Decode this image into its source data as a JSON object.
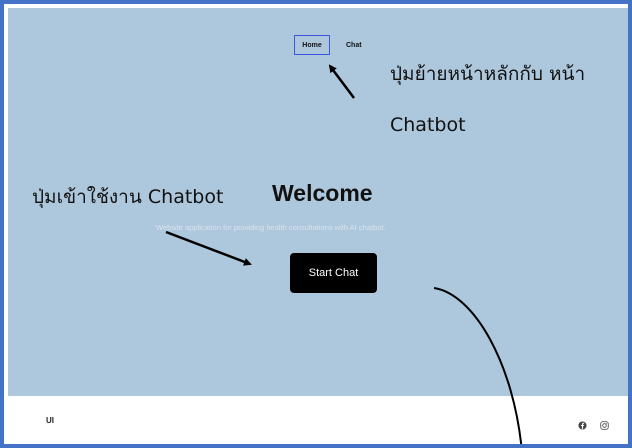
{
  "nav": {
    "home_label": "Home",
    "chat_label": "Chat"
  },
  "hero": {
    "title": "Welcome",
    "subtitle": "Website application for providing health consultations with AI chatbot.",
    "cta_label": "Start Chat",
    "background": "#adc7dc"
  },
  "annotations": {
    "nav_note_line1": "ปุ่มย้ายหน้าหลักกับ หน้า",
    "nav_note_line2": "Chatbot",
    "cta_note": "ปุ่มเข้าใช้งาน Chatbot"
  },
  "footer": {
    "logo": "UI",
    "icons": [
      "facebook-icon",
      "instagram-icon"
    ]
  },
  "colors": {
    "frame_border": "#4472c4",
    "active_nav_border": "#3a56e0",
    "button_bg": "#000000"
  }
}
